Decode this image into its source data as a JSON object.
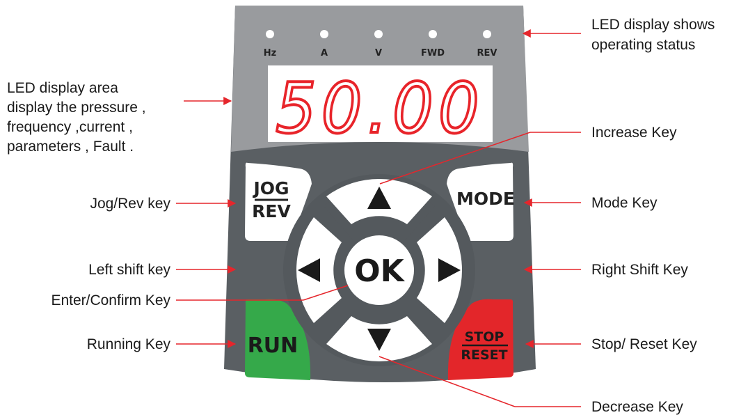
{
  "indicators": [
    "Hz",
    "A",
    "V",
    "FWD",
    "REV"
  ],
  "display_value": "50.00",
  "keys": {
    "jog_top": "JOG",
    "jog_bottom": "REV",
    "mode": "MODE",
    "ok": "OK",
    "run": "RUN",
    "stop_top": "STOP",
    "stop_bottom": "RESET"
  },
  "labels": {
    "led_status_1": "LED display shows",
    "led_status_2": "operating status",
    "display_area_1": "LED display area",
    "display_area_2": "display the pressure ,",
    "display_area_3": "frequency ,current ,",
    "display_area_4": "parameters , Fault .",
    "increase": "Increase Key",
    "jog_rev": "Jog/Rev key",
    "mode": "Mode Key",
    "left_shift": "Left shift key",
    "right_shift": "Right Shift Key",
    "enter": "Enter/Confirm Key",
    "running": "Running Key",
    "stop_reset": "Stop/ Reset Key",
    "decrease": "Decrease Key"
  },
  "colors": {
    "panel_top": "#999b9e",
    "panel_bottom": "#5a5f63",
    "display_digits": "#e8242a",
    "run_key": "#35a94a",
    "stop_key": "#e3262a",
    "callout_line": "#e5262c"
  }
}
